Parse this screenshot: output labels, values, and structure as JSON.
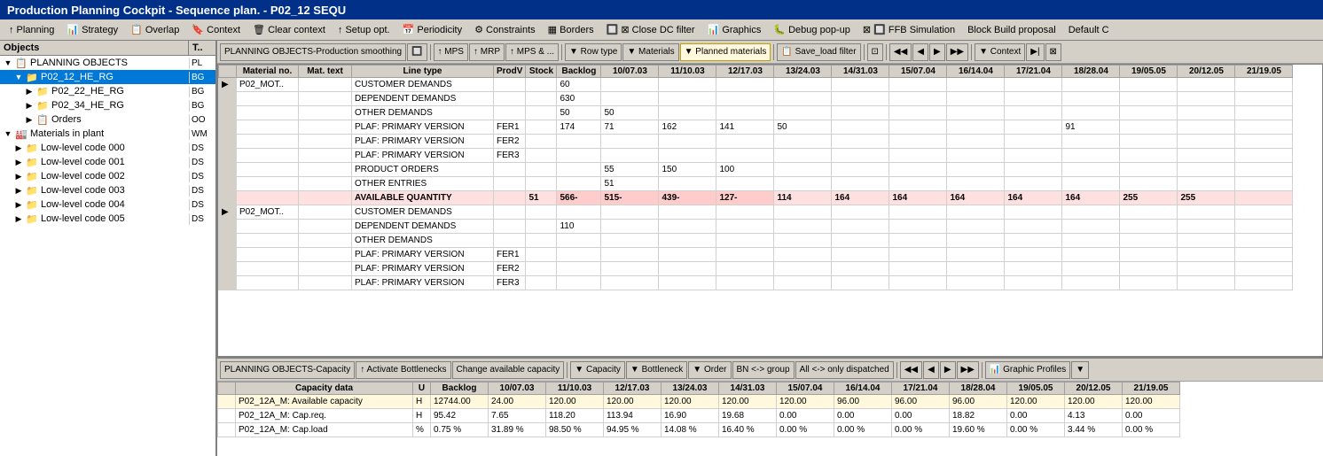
{
  "titleBar": {
    "text": "Production Planning Cockpit - Sequence plan. - P02_12 SEQU"
  },
  "menuBar": {
    "items": [
      {
        "id": "planning",
        "label": "↑ Planning"
      },
      {
        "id": "strategy",
        "label": "Strategy"
      },
      {
        "id": "overlap",
        "label": "Overlap"
      },
      {
        "id": "context",
        "label": "Context"
      },
      {
        "id": "clear-context",
        "label": "Clear context"
      },
      {
        "id": "setup-opt",
        "label": "↑ Setup opt."
      },
      {
        "id": "periodicity",
        "label": "Periodicity"
      },
      {
        "id": "constraints",
        "label": "Constraints"
      },
      {
        "id": "borders",
        "label": "Borders"
      },
      {
        "id": "close-dc-filter",
        "label": "Close DC filter"
      },
      {
        "id": "graphics",
        "label": "Graphics"
      },
      {
        "id": "debug-popup",
        "label": "Debug pop-up"
      },
      {
        "id": "ffb-simulation",
        "label": "FFB Simulation"
      },
      {
        "id": "block-build",
        "label": "Block Build proposal"
      },
      {
        "id": "default-c",
        "label": "Default C"
      }
    ]
  },
  "leftPanel": {
    "header": {
      "col1": "Objects",
      "col2": "T.."
    },
    "tree": [
      {
        "indent": 0,
        "expand": "▼",
        "icon": "📋",
        "label": "PLANNING OBJECTS",
        "code": "PL"
      },
      {
        "indent": 1,
        "expand": "▼",
        "icon": "📁",
        "label": "P02_12_HE_RG",
        "code": "BG",
        "selected": true
      },
      {
        "indent": 2,
        "expand": "▶",
        "icon": "📁",
        "label": "P02_22_HE_RG",
        "code": "BG"
      },
      {
        "indent": 2,
        "expand": "▶",
        "icon": "📁",
        "label": "P02_34_HE_RG",
        "code": "BG"
      },
      {
        "indent": 2,
        "expand": "▶",
        "icon": "📋",
        "label": "Orders",
        "code": "OO"
      },
      {
        "indent": 0,
        "expand": "▼",
        "icon": "🏭",
        "label": "Materials in plant",
        "code": "WM"
      },
      {
        "indent": 1,
        "expand": "▶",
        "icon": "📁",
        "label": "Low-level code 000",
        "code": "DS"
      },
      {
        "indent": 1,
        "expand": "▶",
        "icon": "📁",
        "label": "Low-level code 001",
        "code": "DS"
      },
      {
        "indent": 1,
        "expand": "▶",
        "icon": "📁",
        "label": "Low-level code 002",
        "code": "DS"
      },
      {
        "indent": 1,
        "expand": "▶",
        "icon": "📁",
        "label": "Low-level code 003",
        "code": "DS"
      },
      {
        "indent": 1,
        "expand": "▶",
        "icon": "📁",
        "label": "Low-level code 004",
        "code": "DS"
      },
      {
        "indent": 1,
        "expand": "▶",
        "icon": "📁",
        "label": "Low-level code 005",
        "code": "DS"
      }
    ]
  },
  "upperToolbar": {
    "buttons": [
      {
        "id": "planning-objects",
        "label": "PLANNING OBJECTS-Production smoothing"
      },
      {
        "id": "icon1",
        "label": "🔲"
      },
      {
        "id": "mps",
        "label": "↑ MPS"
      },
      {
        "id": "mrp",
        "label": "↑ MRP"
      },
      {
        "id": "mps-and",
        "label": "↑ MPS & ..."
      },
      {
        "id": "row-type",
        "label": "▼ Row type"
      },
      {
        "id": "materials",
        "label": "▼ Materials"
      },
      {
        "id": "planned-materials",
        "label": "▼ Planned materials"
      },
      {
        "id": "save-load",
        "label": "📋 Save_load filter"
      },
      {
        "id": "nav-prev2",
        "label": "◀◀"
      },
      {
        "id": "nav-prev",
        "label": "◀"
      },
      {
        "id": "nav-next",
        "label": "▶"
      },
      {
        "id": "nav-next2",
        "label": "▶▶"
      },
      {
        "id": "context-btn",
        "label": "▼ Context"
      },
      {
        "id": "nav-end",
        "label": "▶|"
      },
      {
        "id": "icon-extra",
        "label": "⊠"
      }
    ]
  },
  "gridHeader": {
    "cols": [
      "",
      "Material no.",
      "Mat. text",
      "Line type",
      "ProdV",
      "Stock",
      "Backlog",
      "10/07.03",
      "11/10.03",
      "12/17.03",
      "13/24.03",
      "14/31.03",
      "15/07.04",
      "16/14.04",
      "17/21.04",
      "18/28.04",
      "19/05.05",
      "20/12.05",
      "21/19.05"
    ]
  },
  "gridRows": [
    {
      "icon": "▶",
      "mat": "P02_MOT..",
      "matText": "",
      "lineType": "CUSTOMER DEMANDS",
      "prodV": "",
      "stock": "",
      "backlog": "60",
      "d1": "",
      "d2": "",
      "d3": "",
      "d4": "",
      "d5": "",
      "d6": "",
      "d7": "",
      "d8": "",
      "d9": "",
      "d10": "",
      "d11": "",
      "d12": "",
      "style": ""
    },
    {
      "icon": "",
      "mat": "",
      "matText": "",
      "lineType": "DEPENDENT DEMANDS",
      "prodV": "",
      "stock": "",
      "backlog": "630",
      "d1": "",
      "d2": "",
      "d3": "",
      "d4": "",
      "d5": "",
      "d6": "",
      "d7": "",
      "d8": "",
      "d9": "",
      "d10": "",
      "d11": "",
      "d12": "",
      "style": ""
    },
    {
      "icon": "",
      "mat": "",
      "matText": "",
      "lineType": "OTHER DEMANDS",
      "prodV": "",
      "stock": "",
      "backlog": "50",
      "d1": "50",
      "d2": "",
      "d3": "",
      "d4": "",
      "d5": "",
      "d6": "",
      "d7": "",
      "d8": "",
      "d9": "",
      "d10": "",
      "d11": "",
      "d12": "",
      "style": ""
    },
    {
      "icon": "",
      "mat": "",
      "matText": "",
      "lineType": "PLAF: PRIMARY VERSION",
      "prodV": "FER1",
      "stock": "",
      "backlog": "174",
      "d1": "71",
      "d2": "162",
      "d3": "141",
      "d4": "50",
      "d5": "",
      "d6": "",
      "d7": "",
      "d8": "",
      "d9": "91",
      "d10": "",
      "d11": "",
      "d12": "",
      "style": ""
    },
    {
      "icon": "",
      "mat": "",
      "matText": "",
      "lineType": "PLAF: PRIMARY VERSION",
      "prodV": "FER2",
      "stock": "",
      "backlog": "",
      "d1": "",
      "d2": "",
      "d3": "",
      "d4": "",
      "d5": "",
      "d6": "",
      "d7": "",
      "d8": "",
      "d9": "",
      "d10": "",
      "d11": "",
      "d12": "",
      "style": ""
    },
    {
      "icon": "",
      "mat": "",
      "matText": "",
      "lineType": "PLAF: PRIMARY VERSION",
      "prodV": "FER3",
      "stock": "",
      "backlog": "",
      "d1": "",
      "d2": "",
      "d3": "",
      "d4": "",
      "d5": "",
      "d6": "",
      "d7": "",
      "d8": "",
      "d9": "",
      "d10": "",
      "d11": "",
      "d12": "",
      "style": ""
    },
    {
      "icon": "",
      "mat": "",
      "matText": "",
      "lineType": "PRODUCT ORDERS",
      "prodV": "",
      "stock": "",
      "backlog": "",
      "d1": "55",
      "d2": "150",
      "d3": "100",
      "d4": "",
      "d5": "",
      "d6": "",
      "d7": "",
      "d8": "",
      "d9": "",
      "d10": "",
      "d11": "",
      "d12": "",
      "style": ""
    },
    {
      "icon": "",
      "mat": "",
      "matText": "",
      "lineType": "OTHER ENTRIES",
      "prodV": "",
      "stock": "",
      "backlog": "",
      "d1": "51",
      "d2": "",
      "d3": "",
      "d4": "",
      "d5": "",
      "d6": "",
      "d7": "",
      "d8": "",
      "d9": "",
      "d10": "",
      "d11": "",
      "d12": "",
      "style": ""
    },
    {
      "icon": "",
      "mat": "",
      "matText": "",
      "lineType": "AVAILABLE QUANTITY",
      "prodV": "",
      "stock": "51",
      "backlog": "566-",
      "d1": "515-",
      "d2": "439-",
      "d3": "127-",
      "d4": "114",
      "d5": "164",
      "d6": "164",
      "d7": "164",
      "d8": "164",
      "d9": "164",
      "d10": "255",
      "d11": "255",
      "d12": "",
      "style": "negative"
    },
    {
      "icon": "▶",
      "mat": "P02_MOT..",
      "matText": "",
      "lineType": "CUSTOMER DEMANDS",
      "prodV": "",
      "stock": "",
      "backlog": "",
      "d1": "",
      "d2": "",
      "d3": "",
      "d4": "",
      "d5": "",
      "d6": "",
      "d7": "",
      "d8": "",
      "d9": "",
      "d10": "",
      "d11": "",
      "d12": "",
      "style": ""
    },
    {
      "icon": "",
      "mat": "",
      "matText": "",
      "lineType": "DEPENDENT DEMANDS",
      "prodV": "",
      "stock": "",
      "backlog": "110",
      "d1": "",
      "d2": "",
      "d3": "",
      "d4": "",
      "d5": "",
      "d6": "",
      "d7": "",
      "d8": "",
      "d9": "",
      "d10": "",
      "d11": "",
      "d12": "",
      "style": ""
    },
    {
      "icon": "",
      "mat": "",
      "matText": "",
      "lineType": "OTHER DEMANDS",
      "prodV": "",
      "stock": "",
      "backlog": "",
      "d1": "",
      "d2": "",
      "d3": "",
      "d4": "",
      "d5": "",
      "d6": "",
      "d7": "",
      "d8": "",
      "d9": "",
      "d10": "",
      "d11": "",
      "d12": "",
      "style": ""
    },
    {
      "icon": "",
      "mat": "",
      "matText": "",
      "lineType": "PLAF: PRIMARY VERSION",
      "prodV": "FER1",
      "stock": "",
      "backlog": "",
      "d1": "",
      "d2": "",
      "d3": "",
      "d4": "",
      "d5": "",
      "d6": "",
      "d7": "",
      "d8": "",
      "d9": "",
      "d10": "",
      "d11": "",
      "d12": "",
      "style": ""
    },
    {
      "icon": "",
      "mat": "",
      "matText": "",
      "lineType": "PLAF: PRIMARY VERSION",
      "prodV": "FER2",
      "stock": "",
      "backlog": "",
      "d1": "",
      "d2": "",
      "d3": "",
      "d4": "",
      "d5": "",
      "d6": "",
      "d7": "",
      "d8": "",
      "d9": "",
      "d10": "",
      "d11": "",
      "d12": "",
      "style": ""
    },
    {
      "icon": "",
      "mat": "",
      "matText": "",
      "lineType": "PLAF: PRIMARY VERSION",
      "prodV": "FER3",
      "stock": "",
      "backlog": "",
      "d1": "",
      "d2": "",
      "d3": "",
      "d4": "",
      "d5": "",
      "d6": "",
      "d7": "",
      "d8": "",
      "d9": "",
      "d10": "",
      "d11": "",
      "d12": "",
      "style": ""
    }
  ],
  "lowerToolbar": {
    "buttons": [
      {
        "id": "cap-planning",
        "label": "PLANNING OBJECTS-Capacity"
      },
      {
        "id": "activate-btn",
        "label": "↑ Activate Bottlenecks"
      },
      {
        "id": "change-cap",
        "label": "Change available capacity"
      },
      {
        "id": "capacity-btn",
        "label": "▼ Capacity"
      },
      {
        "id": "bottleneck-btn",
        "label": "▼ Bottleneck"
      },
      {
        "id": "order-btn",
        "label": "▼ Order"
      },
      {
        "id": "bn-group",
        "label": "BN <-> group"
      },
      {
        "id": "all-dispatched",
        "label": "All <-> only dispatched"
      },
      {
        "id": "nav2-prev2",
        "label": "◀◀"
      },
      {
        "id": "nav2-prev",
        "label": "◀"
      },
      {
        "id": "nav2-next",
        "label": "▶"
      },
      {
        "id": "nav2-next2",
        "label": "▶▶"
      },
      {
        "id": "graphic-profiles",
        "label": "📊 Graphic Profiles"
      },
      {
        "id": "extra-btn",
        "label": "▼"
      }
    ]
  },
  "capacityHeader": {
    "cols": [
      "",
      "Capacity data",
      "U",
      "Backlog",
      "10/07.03",
      "11/10.03",
      "12/17.03",
      "13/24.03",
      "14/31.03",
      "15/07.04",
      "16/14.04",
      "17/21.04",
      "18/28.04",
      "19/05.05",
      "20/12.05",
      "21/19.05"
    ]
  },
  "capacityRows": [
    {
      "icon": "",
      "label": "P02_12A_M: Available capacity",
      "unit": "H",
      "backlog": "12744.00",
      "d1": "24.00",
      "d2": "120.00",
      "d3": "120.00",
      "d4": "120.00",
      "d5": "120.00",
      "d6": "120.00",
      "d7": "96.00",
      "d8": "96.00",
      "d9": "96.00",
      "d10": "120.00",
      "d11": "120.00",
      "d12": "120.00",
      "style": "cap-avail"
    },
    {
      "icon": "",
      "label": "P02_12A_M: Cap.req.",
      "unit": "H",
      "backlog": "95.42",
      "d1": "7.65",
      "d2": "118.20",
      "d3": "113.94",
      "d4": "16.90",
      "d5": "19.68",
      "d6": "0.00",
      "d7": "0.00",
      "d8": "0.00",
      "d9": "18.82",
      "d10": "0.00",
      "d11": "4.13",
      "d12": "0.00",
      "style": "cap-req"
    },
    {
      "icon": "",
      "label": "P02_12A_M: Cap.load",
      "unit": "%",
      "backlog": "0.75 %",
      "d1": "31.89 %",
      "d2": "98.50 %",
      "d3": "94.95 %",
      "d4": "14.08 %",
      "d5": "16.40 %",
      "d6": "0.00 %",
      "d7": "0.00 %",
      "d8": "0.00 %",
      "d9": "19.60 %",
      "d10": "0.00 %",
      "d11": "3.44 %",
      "d12": "0.00 %",
      "style": "cap-load"
    }
  ]
}
